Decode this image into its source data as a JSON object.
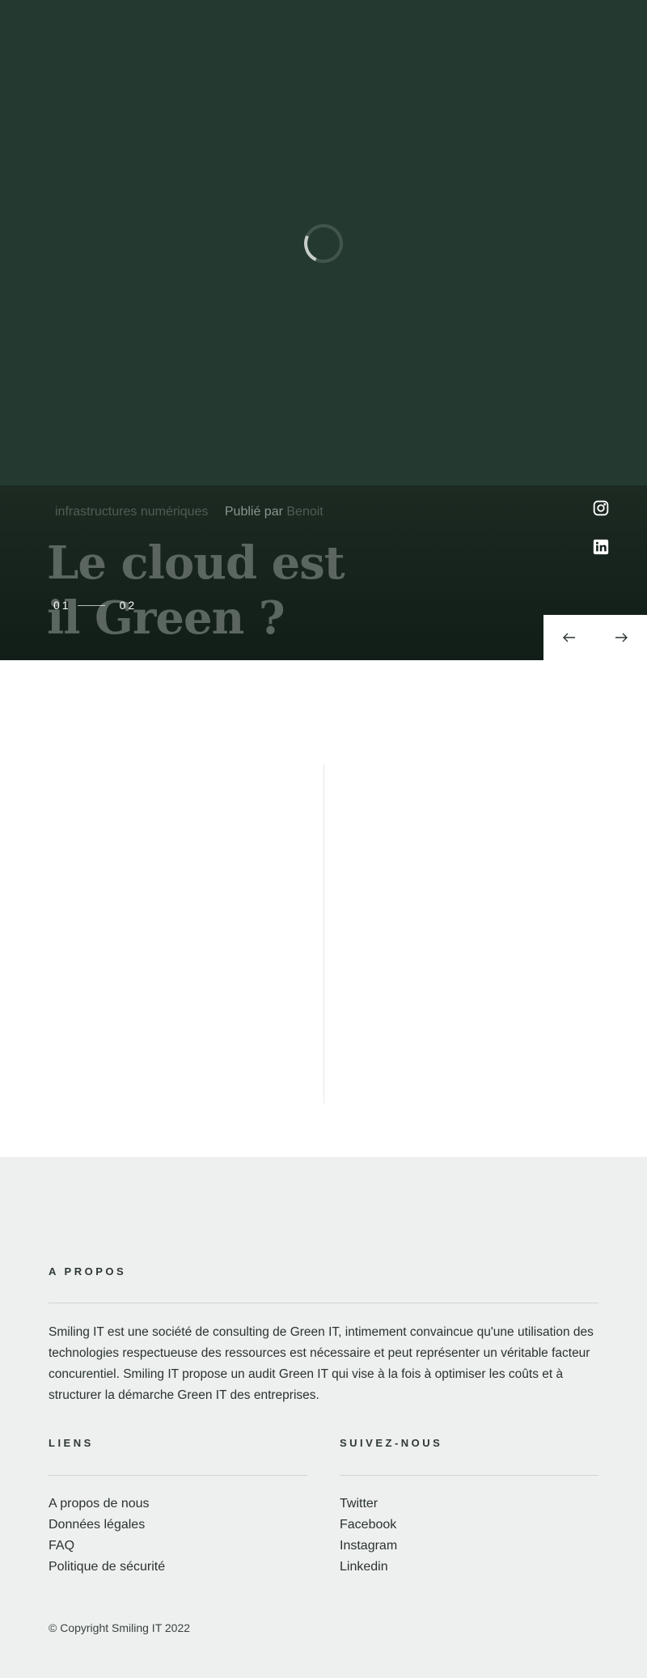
{
  "hero": {
    "loading_indicator": "spinner-icon",
    "background_color": "#243a30"
  },
  "slider": {
    "category": "infrastructures numériques",
    "published_label": "Publié par",
    "author": "Benoit",
    "title": "Le cloud est il Green ?",
    "counter_current": "01",
    "counter_next": "02",
    "social_icons": [
      "instagram-icon",
      "linkedin-icon"
    ],
    "prev_arrow": "←",
    "next_arrow": "→"
  },
  "footer": {
    "about": {
      "heading": "A PROPOS",
      "text": "Smiling IT est une société de consulting de Green IT, intimement convaincue qu'une utilisation des technologies respectueuse des ressources est nécessaire et peut représenter un véritable facteur concurentiel. Smiling IT propose un audit Green IT qui vise à la fois à optimiser les coûts et à structurer la démarche Green IT des entreprises."
    },
    "links": {
      "heading": "LIENS",
      "items": [
        "A propos de nous",
        "Données légales",
        "FAQ",
        "Politique de sécurité"
      ]
    },
    "follow": {
      "heading": "SUIVEZ-NOUS",
      "items": [
        "Twitter",
        "Facebook",
        "Instagram",
        "Linkedin"
      ]
    },
    "copyright": "© Copyright Smiling IT 2022",
    "background_color": "#eef0ef"
  }
}
